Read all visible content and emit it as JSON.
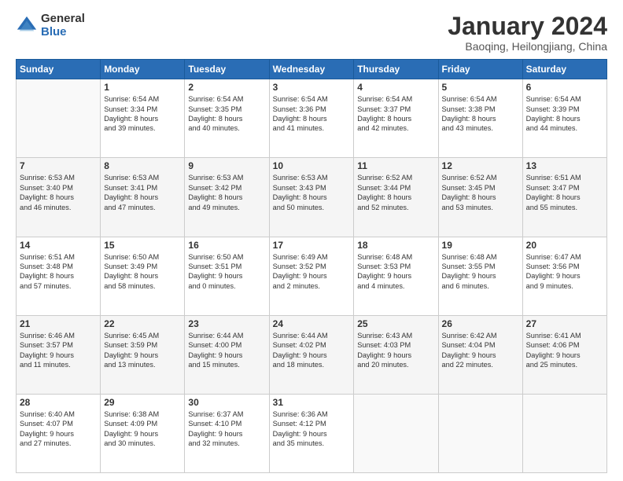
{
  "logo": {
    "general": "General",
    "blue": "Blue"
  },
  "header": {
    "month": "January 2024",
    "location": "Baoqing, Heilongjiang, China"
  },
  "weekdays": [
    "Sunday",
    "Monday",
    "Tuesday",
    "Wednesday",
    "Thursday",
    "Friday",
    "Saturday"
  ],
  "weeks": [
    [
      {
        "day": "",
        "info": ""
      },
      {
        "day": "1",
        "info": "Sunrise: 6:54 AM\nSunset: 3:34 PM\nDaylight: 8 hours\nand 39 minutes."
      },
      {
        "day": "2",
        "info": "Sunrise: 6:54 AM\nSunset: 3:35 PM\nDaylight: 8 hours\nand 40 minutes."
      },
      {
        "day": "3",
        "info": "Sunrise: 6:54 AM\nSunset: 3:36 PM\nDaylight: 8 hours\nand 41 minutes."
      },
      {
        "day": "4",
        "info": "Sunrise: 6:54 AM\nSunset: 3:37 PM\nDaylight: 8 hours\nand 42 minutes."
      },
      {
        "day": "5",
        "info": "Sunrise: 6:54 AM\nSunset: 3:38 PM\nDaylight: 8 hours\nand 43 minutes."
      },
      {
        "day": "6",
        "info": "Sunrise: 6:54 AM\nSunset: 3:39 PM\nDaylight: 8 hours\nand 44 minutes."
      }
    ],
    [
      {
        "day": "7",
        "info": "Sunrise: 6:53 AM\nSunset: 3:40 PM\nDaylight: 8 hours\nand 46 minutes."
      },
      {
        "day": "8",
        "info": "Sunrise: 6:53 AM\nSunset: 3:41 PM\nDaylight: 8 hours\nand 47 minutes."
      },
      {
        "day": "9",
        "info": "Sunrise: 6:53 AM\nSunset: 3:42 PM\nDaylight: 8 hours\nand 49 minutes."
      },
      {
        "day": "10",
        "info": "Sunrise: 6:53 AM\nSunset: 3:43 PM\nDaylight: 8 hours\nand 50 minutes."
      },
      {
        "day": "11",
        "info": "Sunrise: 6:52 AM\nSunset: 3:44 PM\nDaylight: 8 hours\nand 52 minutes."
      },
      {
        "day": "12",
        "info": "Sunrise: 6:52 AM\nSunset: 3:45 PM\nDaylight: 8 hours\nand 53 minutes."
      },
      {
        "day": "13",
        "info": "Sunrise: 6:51 AM\nSunset: 3:47 PM\nDaylight: 8 hours\nand 55 minutes."
      }
    ],
    [
      {
        "day": "14",
        "info": "Sunrise: 6:51 AM\nSunset: 3:48 PM\nDaylight: 8 hours\nand 57 minutes."
      },
      {
        "day": "15",
        "info": "Sunrise: 6:50 AM\nSunset: 3:49 PM\nDaylight: 8 hours\nand 58 minutes."
      },
      {
        "day": "16",
        "info": "Sunrise: 6:50 AM\nSunset: 3:51 PM\nDaylight: 9 hours\nand 0 minutes."
      },
      {
        "day": "17",
        "info": "Sunrise: 6:49 AM\nSunset: 3:52 PM\nDaylight: 9 hours\nand 2 minutes."
      },
      {
        "day": "18",
        "info": "Sunrise: 6:48 AM\nSunset: 3:53 PM\nDaylight: 9 hours\nand 4 minutes."
      },
      {
        "day": "19",
        "info": "Sunrise: 6:48 AM\nSunset: 3:55 PM\nDaylight: 9 hours\nand 6 minutes."
      },
      {
        "day": "20",
        "info": "Sunrise: 6:47 AM\nSunset: 3:56 PM\nDaylight: 9 hours\nand 9 minutes."
      }
    ],
    [
      {
        "day": "21",
        "info": "Sunrise: 6:46 AM\nSunset: 3:57 PM\nDaylight: 9 hours\nand 11 minutes."
      },
      {
        "day": "22",
        "info": "Sunrise: 6:45 AM\nSunset: 3:59 PM\nDaylight: 9 hours\nand 13 minutes."
      },
      {
        "day": "23",
        "info": "Sunrise: 6:44 AM\nSunset: 4:00 PM\nDaylight: 9 hours\nand 15 minutes."
      },
      {
        "day": "24",
        "info": "Sunrise: 6:44 AM\nSunset: 4:02 PM\nDaylight: 9 hours\nand 18 minutes."
      },
      {
        "day": "25",
        "info": "Sunrise: 6:43 AM\nSunset: 4:03 PM\nDaylight: 9 hours\nand 20 minutes."
      },
      {
        "day": "26",
        "info": "Sunrise: 6:42 AM\nSunset: 4:04 PM\nDaylight: 9 hours\nand 22 minutes."
      },
      {
        "day": "27",
        "info": "Sunrise: 6:41 AM\nSunset: 4:06 PM\nDaylight: 9 hours\nand 25 minutes."
      }
    ],
    [
      {
        "day": "28",
        "info": "Sunrise: 6:40 AM\nSunset: 4:07 PM\nDaylight: 9 hours\nand 27 minutes."
      },
      {
        "day": "29",
        "info": "Sunrise: 6:38 AM\nSunset: 4:09 PM\nDaylight: 9 hours\nand 30 minutes."
      },
      {
        "day": "30",
        "info": "Sunrise: 6:37 AM\nSunset: 4:10 PM\nDaylight: 9 hours\nand 32 minutes."
      },
      {
        "day": "31",
        "info": "Sunrise: 6:36 AM\nSunset: 4:12 PM\nDaylight: 9 hours\nand 35 minutes."
      },
      {
        "day": "",
        "info": ""
      },
      {
        "day": "",
        "info": ""
      },
      {
        "day": "",
        "info": ""
      }
    ]
  ]
}
